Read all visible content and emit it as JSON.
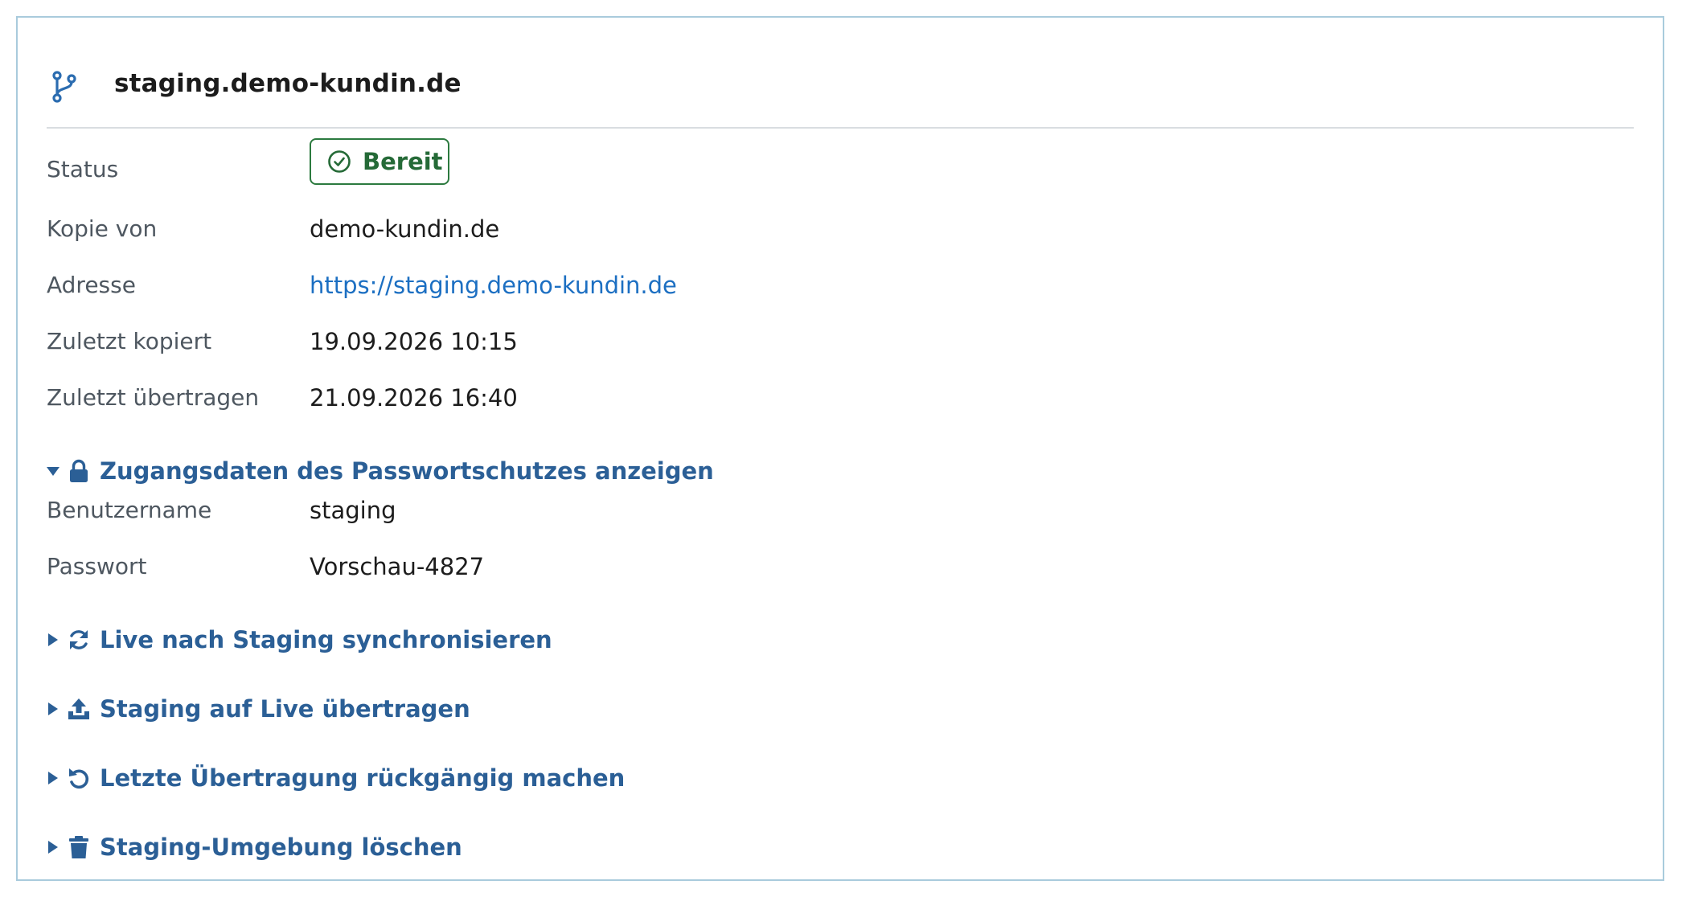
{
  "header": {
    "title": "staging.demo-kundin.de",
    "icon": "git-branch-icon"
  },
  "details": {
    "status_label": "Status",
    "status_value": "Bereit",
    "copy_of_label": "Kopie von",
    "copy_of_value": "demo-kundin.de",
    "address_label": "Adresse",
    "address_value": "https://staging.demo-kundin.de",
    "last_copied_label": "Zuletzt kopiert",
    "last_copied_value": "19.09.2026 10:15",
    "last_transferred_label": "Zuletzt übertragen",
    "last_transferred_value": "21.09.2026 16:40"
  },
  "credentials": {
    "toggle_label": "Zugangsdaten des Passwortschutzes anzeigen",
    "expanded": true,
    "username_label": "Benutzername",
    "username_value": "staging",
    "password_label": "Passwort",
    "password_value": "Vorschau-4827"
  },
  "actions": {
    "sync": "Live nach Staging synchronisieren",
    "push": "Staging auf Live übertragen",
    "undo": "Letzte Übertragung rückgängig machen",
    "delete": "Staging-Umgebung löschen"
  },
  "colors": {
    "accent": "#2b5f96",
    "link": "#1c6fc2",
    "success": "#2c7a3f",
    "border": "#a9cbdc"
  }
}
